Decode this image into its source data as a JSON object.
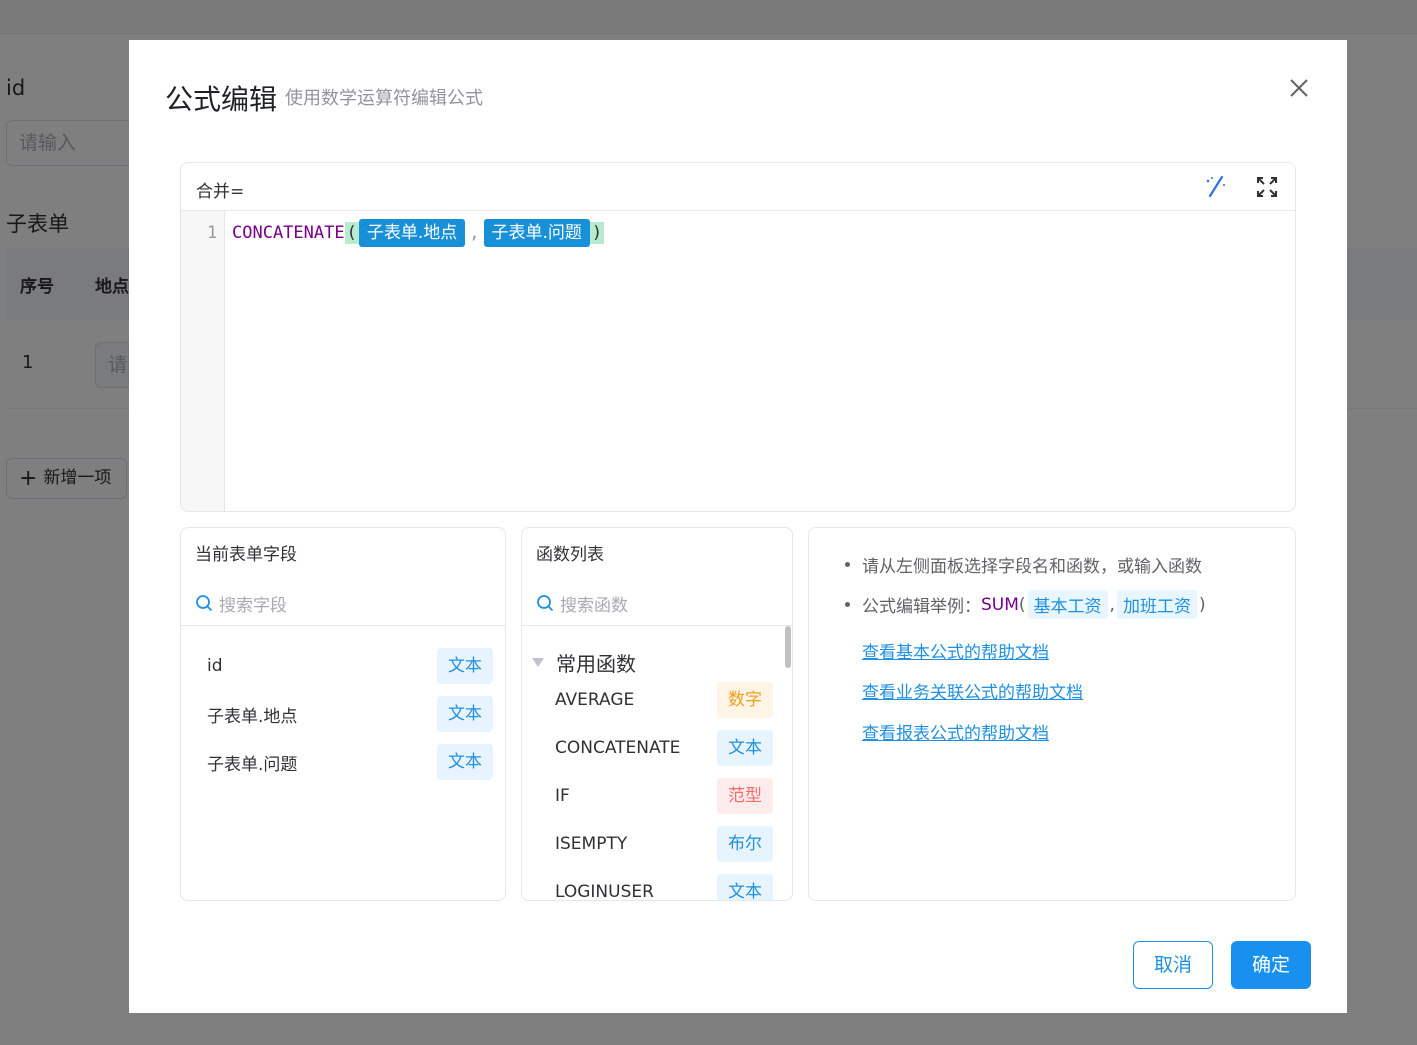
{
  "background": {
    "field_label": "id",
    "input_placeholder": "请输入",
    "subtable_title": "子表单",
    "columns": [
      "序号",
      "地点"
    ],
    "row_index": "1",
    "row_input_placeholder": "请",
    "add_button": "新增一项"
  },
  "dialog": {
    "title": "公式编辑",
    "subtitle": "使用数学运算符编辑公式",
    "editor": {
      "label": "合并=",
      "line_number": "1",
      "function": "CONCATENATE",
      "open_paren": "(",
      "close_paren": ")",
      "separator": ",",
      "args": [
        "子表单.地点",
        "子表单.问题"
      ]
    },
    "fields_panel": {
      "title": "当前表单字段",
      "search_placeholder": "搜索字段",
      "items": [
        {
          "name": "id",
          "type": "文本"
        },
        {
          "name": "子表单.地点",
          "type": "文本"
        },
        {
          "name": "子表单.问题",
          "type": "文本"
        }
      ]
    },
    "functions_panel": {
      "title": "函数列表",
      "search_placeholder": "搜索函数",
      "group": "常用函数",
      "items": [
        {
          "name": "AVERAGE",
          "type": "数字",
          "style": "num"
        },
        {
          "name": "CONCATENATE",
          "type": "文本",
          "style": "text"
        },
        {
          "name": "IF",
          "type": "范型",
          "style": "gen"
        },
        {
          "name": "ISEMPTY",
          "type": "布尔",
          "style": "bool"
        },
        {
          "name": "LOGINUSER",
          "type": "文本",
          "style": "text"
        }
      ]
    },
    "help_panel": {
      "tip": "请从左侧面板选择字段名和函数，或输入函数",
      "example_label": "公式编辑举例：",
      "example_fn": "SUM",
      "example_open": "(",
      "example_args": [
        "基本工资",
        "加班工资"
      ],
      "example_sep": ",",
      "example_close": ")",
      "links": [
        "查看基本公式的帮助文档",
        "查看业务关联公式的帮助文档",
        "查看报表公式的帮助文档"
      ]
    },
    "buttons": {
      "cancel": "取消",
      "ok": "确定"
    }
  },
  "colors": {
    "primary": "#1890f0",
    "field_tag_bg": "#1890d8",
    "function_color": "#770088"
  }
}
